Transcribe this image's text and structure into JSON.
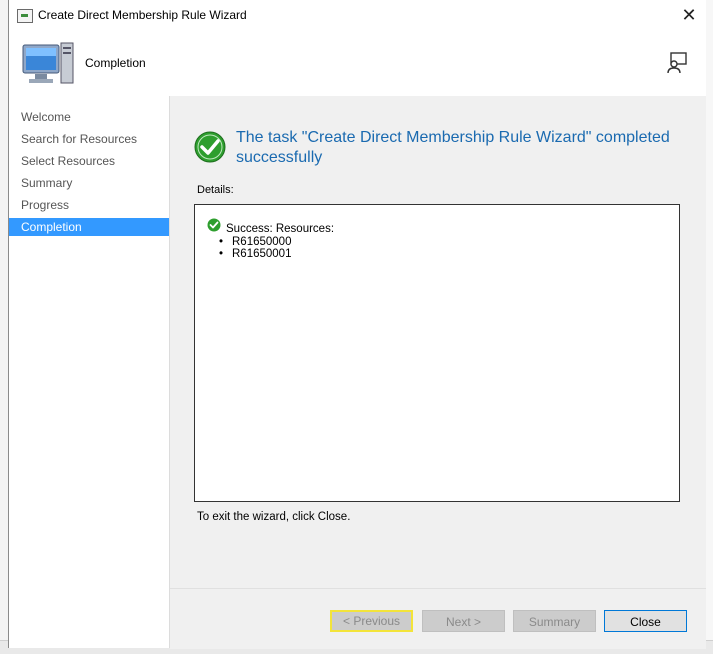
{
  "window": {
    "title": "Create Direct Membership Rule Wizard",
    "page_title": "Completion"
  },
  "nav": {
    "items": [
      {
        "label": "Welcome",
        "active": false
      },
      {
        "label": "Search for Resources",
        "active": false
      },
      {
        "label": "Select Resources",
        "active": false
      },
      {
        "label": "Summary",
        "active": false
      },
      {
        "label": "Progress",
        "active": false
      },
      {
        "label": "Completion",
        "active": true
      }
    ]
  },
  "content": {
    "result_title": "The task \"Create Direct Membership Rule Wizard\" completed successfully",
    "details_label": "Details:",
    "success_text": "Success: Resources:",
    "resources": [
      "R61650000",
      "R61650001"
    ],
    "exit_text": "To exit the wizard, click Close."
  },
  "footer": {
    "previous_label": "< Previous",
    "next_label": "Next >",
    "summary_label": "Summary",
    "close_label": "Close"
  },
  "colors": {
    "accent": "#3399ff",
    "title_blue": "#1a6ab0",
    "success_green": "#2e9e2e"
  },
  "icons": {
    "title": "wizard-window-icon",
    "header": "computer-monitor-icon",
    "help": "person-help-icon",
    "success": "check-circle-icon"
  }
}
